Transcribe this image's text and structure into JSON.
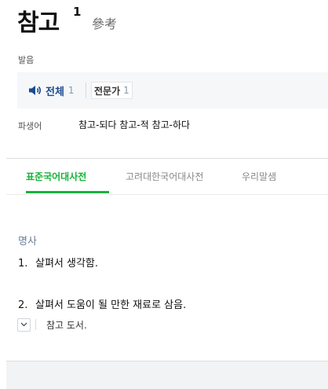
{
  "headword": {
    "word": "참고",
    "superscript": "1",
    "hanja": "參考"
  },
  "pronunciation": {
    "label": "발음",
    "all_label": "전체",
    "all_count": "1",
    "expert_label": "전문가",
    "expert_count": "1"
  },
  "derivatives": {
    "label": "파생어",
    "words": "참고-되다 참고-적 참고-하다"
  },
  "tabs": [
    {
      "label": "표준국어대사전",
      "active": true
    },
    {
      "label": "고려대한국어대사전",
      "active": false
    },
    {
      "label": "우리말샘",
      "active": false
    }
  ],
  "entry": {
    "pos": "명사",
    "definitions": [
      {
        "num": "1.",
        "text": "살펴서 생각함."
      },
      {
        "num": "2.",
        "text": "살펴서 도움이 될 만한 재료로 삼음."
      }
    ],
    "example": "참고 도서."
  },
  "colors": {
    "accent_green": "#18b33b",
    "pron_blue": "#1c4a8e",
    "pos_gray_blue": "#6b7f99"
  }
}
